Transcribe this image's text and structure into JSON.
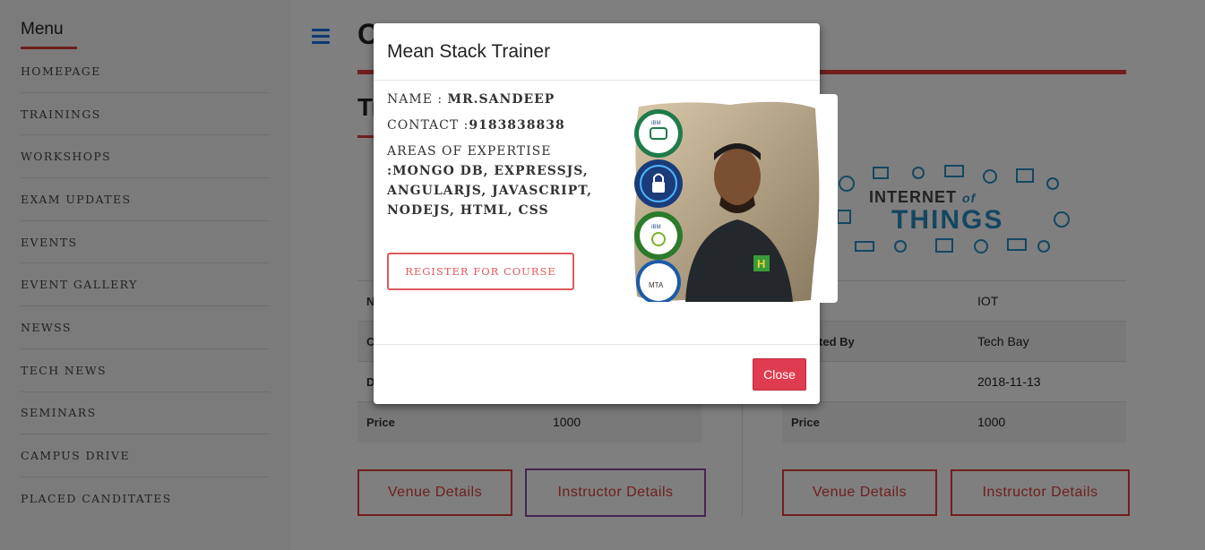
{
  "sidebar": {
    "title": "Menu",
    "items": [
      {
        "label": "HOMEPAGE"
      },
      {
        "label": "TRAININGS"
      },
      {
        "label": "WORKSHOPS"
      },
      {
        "label": "EXAM UPDATES"
      },
      {
        "label": "EVENTS"
      },
      {
        "label": "EVENT GALLERY"
      },
      {
        "label": "NEWSS"
      },
      {
        "label": "TECH NEWS"
      },
      {
        "label": "SEMINARS"
      },
      {
        "label": "CAMPUS DRIVE"
      },
      {
        "label": "PLACED CANDITATES"
      }
    ]
  },
  "main": {
    "heading_visible": "O",
    "section_visible": "Tr",
    "left_card": {
      "rows": [
        {
          "key": "N",
          "value": ""
        },
        {
          "key": "C",
          "value": ""
        },
        {
          "key": "D",
          "value": ""
        },
        {
          "key": "Price",
          "value": "1000"
        }
      ],
      "venue_label": "Venue Details",
      "instructor_label": "Instructor Details"
    },
    "right_card": {
      "image_text_1": "INTERNET",
      "image_text_of": "of",
      "image_text_2": "THINGS",
      "rows": [
        {
          "key": "",
          "value": "IOT"
        },
        {
          "key": "nducted By",
          "value": "Tech Bay"
        },
        {
          "key": "",
          "value": "2018-11-13"
        },
        {
          "key": "Price",
          "value": "1000"
        }
      ],
      "venue_label": "Venue Details",
      "instructor_label": "Instructor Details"
    }
  },
  "modal": {
    "title": "Mean Stack Trainer",
    "name_label": "NAME : ",
    "name_value": "MR.SANDEEP",
    "contact_label": "CONTACT :",
    "contact_value": "9183838838",
    "expertise_label": "AREAS OF EXPERTISE",
    "expertise_value": ":MONGO DB, EXPRESSJS, ANGULARJS, JAVASCRIPT, NODEJS, HTML, CSS",
    "register_label": "REGISTER FOR COURSE",
    "close_label": "Close",
    "badges": [
      "IBM",
      "",
      "IBM",
      "MTA"
    ]
  },
  "colors": {
    "accent_red": "#e03c3c",
    "close_button": "#e03c4f",
    "hamburger_blue": "#1e73e8",
    "iot_blue": "#2a8fc0"
  }
}
